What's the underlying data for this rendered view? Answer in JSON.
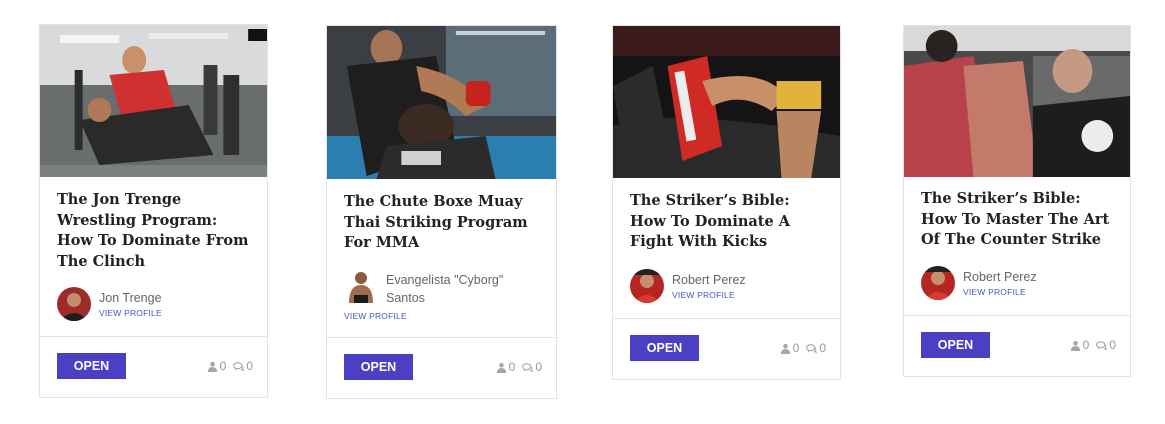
{
  "open_label": "OPEN",
  "cards": [
    {
      "title": "The Jon Trenge Wrestling Program: How To Dominate From The Clinch",
      "author": "Jon Trenge",
      "view_profile": "VIEW PROFILE",
      "likes": "0",
      "comments": "0"
    },
    {
      "title": "The Chute Boxe Muay Thai Striking Program For MMA",
      "author": "Evangelista \"Cyborg\" Santos",
      "view_profile": "VIEW PROFILE",
      "likes": "0",
      "comments": "0"
    },
    {
      "title": "The Striker’s Bible: How To Dominate A Fight With Kicks",
      "author": "Robert Perez",
      "view_profile": "VIEW PROFILE",
      "likes": "0",
      "comments": "0"
    },
    {
      "title": "The Striker’s Bible: How To Master The Art Of The Counter Strike",
      "author": "Robert Perez",
      "view_profile": "VIEW PROFILE",
      "likes": "0",
      "comments": "0"
    }
  ],
  "colors": {
    "accent": "#4b3fc4",
    "link": "#4a55c6",
    "border": "#e3e3e3"
  }
}
